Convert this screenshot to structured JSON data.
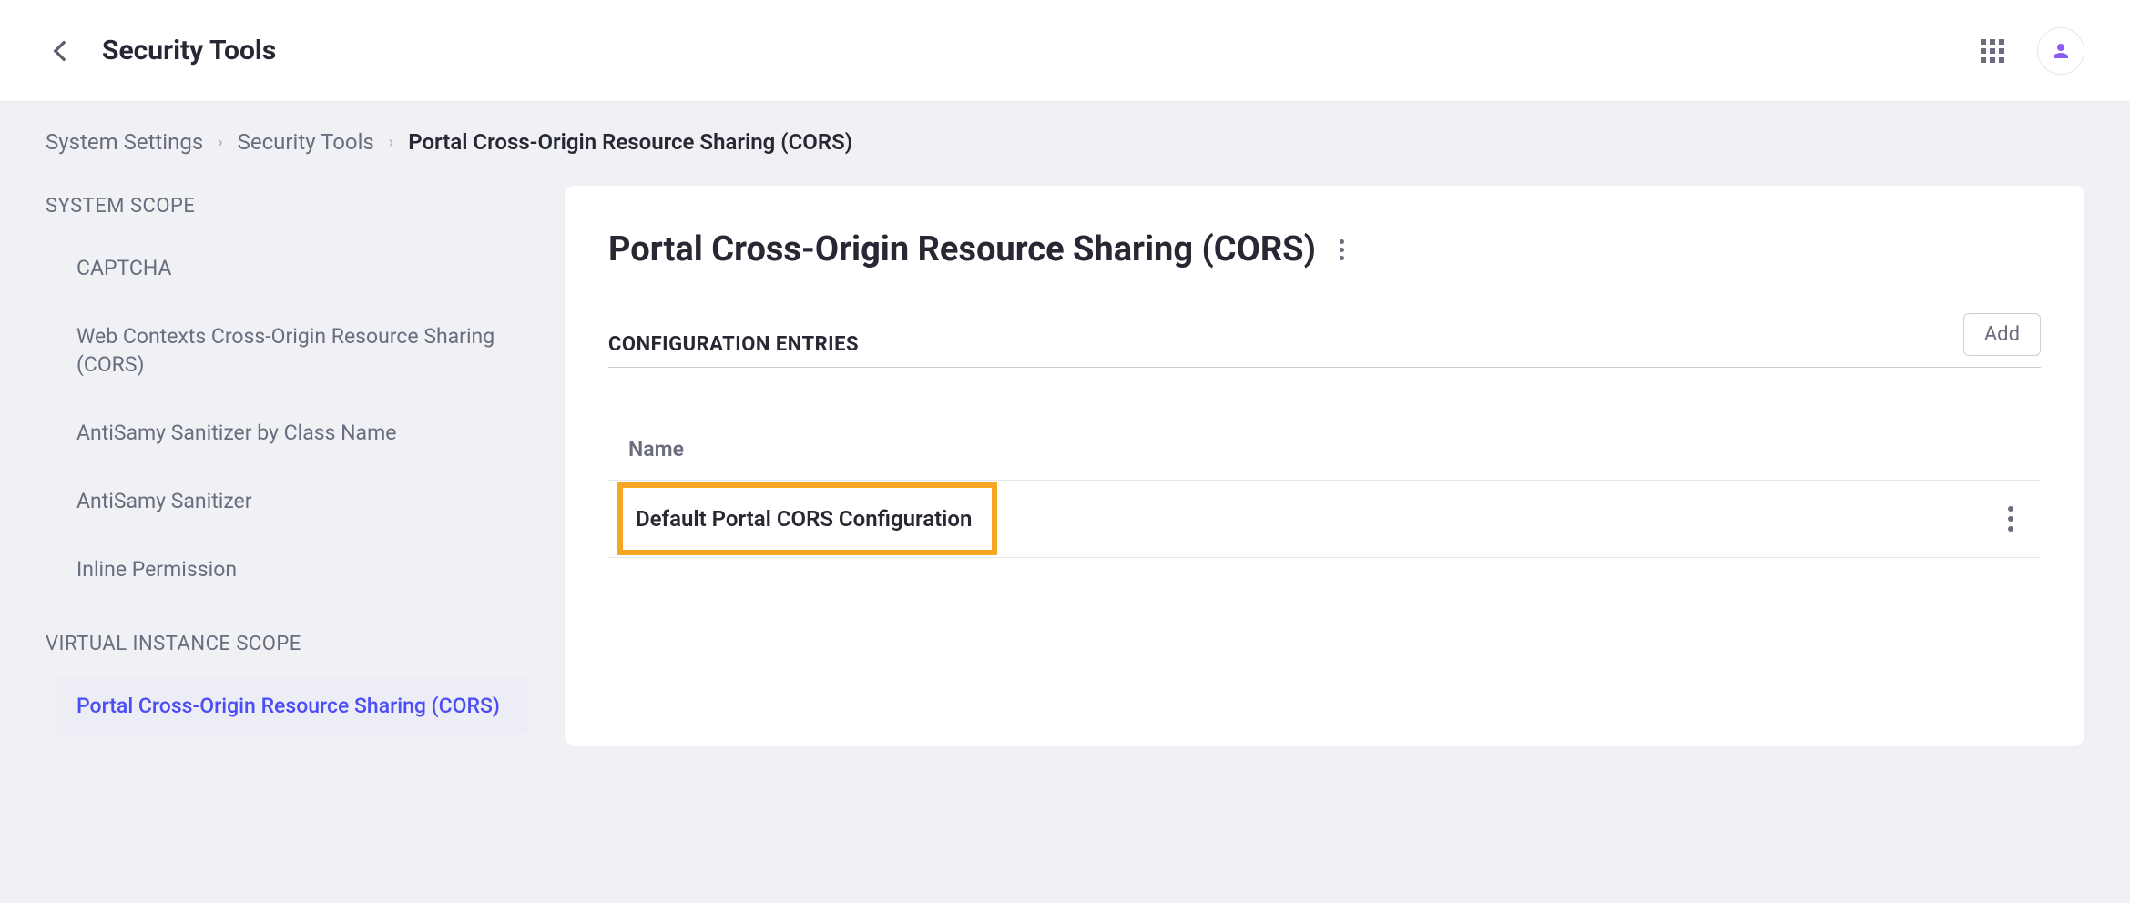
{
  "header": {
    "title": "Security Tools"
  },
  "breadcrumb": {
    "items": [
      {
        "label": "System Settings",
        "current": false
      },
      {
        "label": "Security Tools",
        "current": false
      },
      {
        "label": "Portal Cross-Origin Resource Sharing (CORS)",
        "current": true
      }
    ]
  },
  "sidebar": {
    "sections": [
      {
        "title": "SYSTEM SCOPE",
        "items": [
          {
            "label": "CAPTCHA",
            "active": false
          },
          {
            "label": "Web Contexts Cross-Origin Resource Sharing (CORS)",
            "active": false
          },
          {
            "label": "AntiSamy Sanitizer by Class Name",
            "active": false
          },
          {
            "label": "AntiSamy Sanitizer",
            "active": false
          },
          {
            "label": "Inline Permission",
            "active": false
          }
        ]
      },
      {
        "title": "VIRTUAL INSTANCE SCOPE",
        "items": [
          {
            "label": "Portal Cross-Origin Resource Sharing (CORS)",
            "active": true
          }
        ]
      }
    ]
  },
  "main": {
    "title": "Portal Cross-Origin Resource Sharing (CORS)",
    "section_heading": "CONFIGURATION ENTRIES",
    "add_button": "Add",
    "table": {
      "column_header": "Name",
      "rows": [
        {
          "name": "Default Portal CORS Configuration"
        }
      ]
    }
  }
}
